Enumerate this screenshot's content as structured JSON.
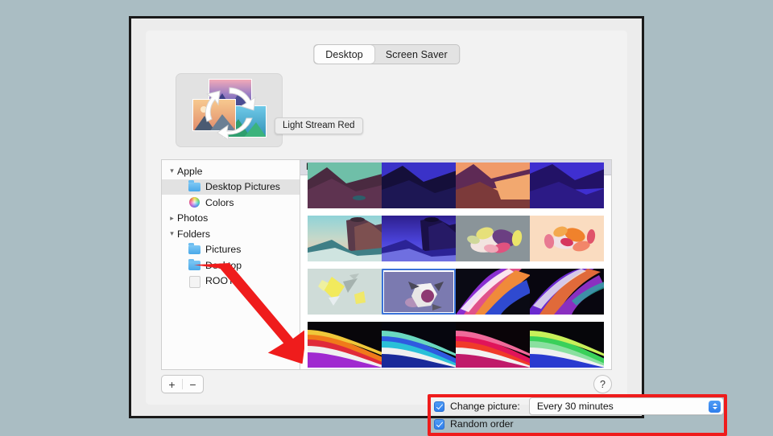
{
  "window": {
    "tabs": [
      {
        "label": "Desktop",
        "active": true
      },
      {
        "label": "Screen Saver",
        "active": false
      }
    ]
  },
  "preview": {
    "tooltip": "Light Stream Red",
    "icon": "rotating-wallpaper-preview"
  },
  "sidebar": {
    "items": [
      {
        "label": "Apple",
        "type": "group",
        "twisty": "down",
        "icon": "none",
        "level": 0,
        "selected": false
      },
      {
        "label": "Desktop Pictures",
        "type": "item",
        "twisty": "none",
        "icon": "folder-icon",
        "level": 1,
        "selected": true
      },
      {
        "label": "Colors",
        "type": "item",
        "twisty": "none",
        "icon": "color-wheel-icon",
        "level": 1,
        "selected": false
      },
      {
        "label": "Photos",
        "type": "group",
        "twisty": "right",
        "icon": "none",
        "level": 0,
        "selected": false
      },
      {
        "label": "Folders",
        "type": "group",
        "twisty": "down",
        "icon": "none",
        "level": 0,
        "selected": false
      },
      {
        "label": "Pictures",
        "type": "item",
        "twisty": "none",
        "icon": "folder-icon",
        "level": 1,
        "selected": false
      },
      {
        "label": "Desktop",
        "type": "item",
        "twisty": "none",
        "icon": "folder-icon",
        "level": 1,
        "selected": false
      },
      {
        "label": "ROOTE",
        "type": "item",
        "twisty": "none",
        "icon": "blank-icon",
        "level": 1,
        "selected": false
      }
    ],
    "add_label": "+",
    "remove_label": "−"
  },
  "gallery": {
    "header": "Desktop Pictures",
    "rows": [
      [
        {
          "name": "big-sur-dusk-clipped",
          "selected": false
        },
        {
          "name": "big-sur-night-clipped",
          "selected": false
        },
        {
          "name": "catalina-sunset-clipped",
          "selected": false
        },
        {
          "name": "catalina-night-clipped",
          "selected": false
        }
      ],
      [
        {
          "name": "big-sur-coast-day",
          "selected": false
        },
        {
          "name": "big-sur-coast-night",
          "selected": false
        },
        {
          "name": "pebbles-gray",
          "selected": false
        },
        {
          "name": "pebbles-peach",
          "selected": false
        }
      ],
      [
        {
          "name": "crystals-light",
          "selected": false
        },
        {
          "name": "hello-sphere",
          "selected": true
        },
        {
          "name": "light-stream-violet",
          "selected": false
        },
        {
          "name": "light-stream-purple",
          "selected": false
        }
      ],
      [
        {
          "name": "light-stream-orange",
          "selected": false
        },
        {
          "name": "light-stream-blue",
          "selected": false
        },
        {
          "name": "light-stream-red",
          "selected": false
        },
        {
          "name": "light-stream-green",
          "selected": false
        }
      ]
    ]
  },
  "options": {
    "change_picture_label": "Change picture:",
    "change_picture_checked": true,
    "interval_value": "Every 30 minutes",
    "random_order_label": "Random order",
    "random_order_checked": true
  },
  "help": {
    "label": "?"
  },
  "annotation": {
    "arrow_color": "#ef1c1c",
    "highlight_color": "#ef1c1c"
  }
}
